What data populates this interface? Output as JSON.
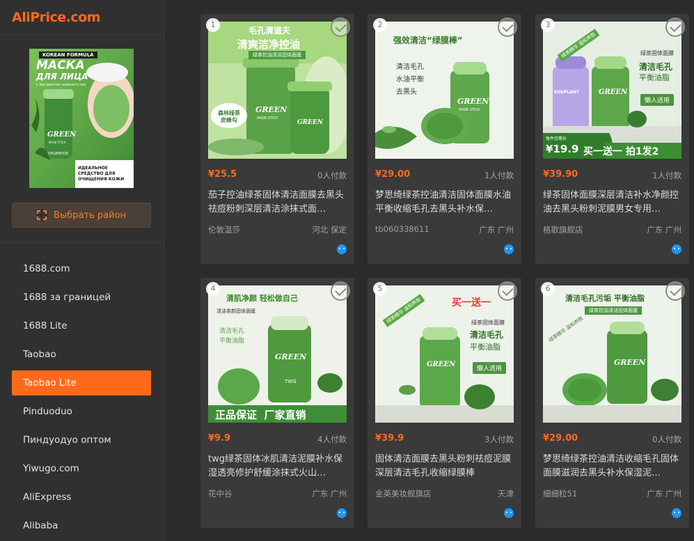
{
  "brand": {
    "name": "AliPrice.com",
    "color": "#ff6a1a"
  },
  "thumbnail": {
    "badge": "KOREAN FORMULA",
    "title_line1": "МАСКА",
    "title_line2": "ДЛЯ ЛИЦА",
    "subtitle": "с экстрактом зеленого чая",
    "product_word": "GREEN",
    "product_sub": "MASK STICK",
    "brand_on_stick": "DEGEMODE",
    "caption": "ИДЕАЛЬНОЕ СРЕДСТВО ДЛЯ ОЧИЩЕНИЯ КОЖИ"
  },
  "region_button": {
    "label": "Выбрать район",
    "icon": "region-frame-icon"
  },
  "sidebar_nav": [
    {
      "label": "1688.com",
      "active": false
    },
    {
      "label": "1688 за границей",
      "active": false
    },
    {
      "label": "1688 Lite",
      "active": false
    },
    {
      "label": "Taobao",
      "active": false
    },
    {
      "label": "Taobao Lite",
      "active": true
    },
    {
      "label": "Pinduoduo",
      "active": false
    },
    {
      "label": "Пиндуодуо оптом",
      "active": false
    },
    {
      "label": "Yiwugo.com",
      "active": false
    },
    {
      "label": "AliExpress",
      "active": false
    },
    {
      "label": "Alibaba",
      "active": false
    }
  ],
  "products": [
    {
      "index": "1",
      "price": "¥25.5",
      "sold": "0人付款",
      "title": "茄子控油绿茶固体清洁面膜去黑头祛痘粉刺深层清洁涂抹式面…",
      "shop": "伦敦温莎",
      "location": "河北 保定",
      "image_text": {
        "top1": "毛孔清道夫",
        "top2": "清爽洁净控油",
        "band": "绿茶控油清洁固体面膜",
        "badge": "森林绿茶 皮蜂勾",
        "stick_word": "GREEN",
        "stick_sub": "MASK STICK"
      }
    },
    {
      "index": "2",
      "price": "¥29.00",
      "sold": "1人付款",
      "title": "梦思绮绿茶控油清洁固体面膜水油平衡收缩毛孔去黑头补水保…",
      "shop": "tb060338611",
      "location": "广东 广州",
      "image_text": {
        "top1": "强效清洁“绿膜棒”",
        "bullets": [
          "清洁毛孔",
          "水油平衡",
          "去黑头"
        ],
        "stick_word": "GREEN",
        "stick_sub": "MASK STICK"
      }
    },
    {
      "index": "3",
      "price": "¥39.90",
      "sold": "1人付款",
      "title": "绿茶固体面膜深层清洁补水净颜控油去黑头粉刺泥膜男女专用…",
      "shop": "格歌旗舰店",
      "location": "广东 广州",
      "image_text": {
        "side": "绿茶固体面膜",
        "line1": "清洁毛孔",
        "line2": "平衡油脂",
        "tag": "懒人适用",
        "diag": "绿茶精华 温和养肤",
        "pill": "每件仅需价",
        "price": "¥19.9",
        "promo": "买一送一 拍1发2",
        "stick_word": "GREEN",
        "stick2_word": "EGGPLANT"
      }
    },
    {
      "index": "4",
      "price": "¥9.9",
      "sold": "4人付款",
      "title": "twg绿茶固体冰肌清洁泥膜补水保湿透亮修护舒缓涂抹式火山…",
      "shop": "花中谷",
      "location": "广东 广州",
      "image_text": {
        "top1": "清肌净颜 轻松做自己",
        "band": "清洁茶颜固体面膜",
        "line1": "清洁毛孔",
        "line2": "平衡油脂",
        "bottom": "正品保证  厂家直销",
        "stick_word": "GREEN",
        "stick_sub": "TWG"
      }
    },
    {
      "index": "5",
      "price": "¥39.9",
      "sold": "3人付款",
      "title": "固体清洁面膜去黑头粉刺祛痘泥膜深层清洁毛孔收缩绿膜棒",
      "shop": "金英美妆舰旗店",
      "location": "天津",
      "image_text": {
        "promo": "买一送一",
        "diag": "绿茶精华 温和养肤",
        "side": "绿茶固体面膜",
        "line1": "清洁毛孔",
        "line2": "平衡油脂",
        "tag": "懒人适用",
        "stick_word": "GREEN"
      }
    },
    {
      "index": "6",
      "price": "¥29.00",
      "sold": "0人付款",
      "title": "梦思绮绿茶控油清洁收缩毛孔固体面膜滋润去黑头补水保湿泥…",
      "shop": "细细粒51",
      "location": "广东 广州",
      "image_text": {
        "top1": "清洁毛孔污垢 平衡油脂",
        "band": "绿茶控油清洁固体面膜",
        "diag": "绿茶精华 温和养肤",
        "stick_word": "GREEN"
      }
    }
  ]
}
